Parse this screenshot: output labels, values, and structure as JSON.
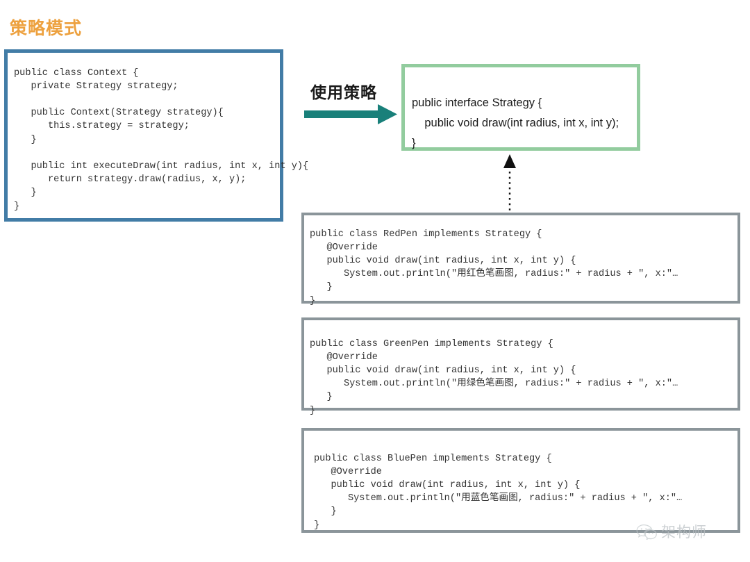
{
  "slide": {
    "title": "策略模式",
    "title_color": "#EDA13F",
    "background": "#ffffff"
  },
  "context_box": {
    "name": "Context",
    "border_color": "#427CA6",
    "code": "public class Context {\n   private Strategy strategy;\n\n   public Context(Strategy strategy){\n      this.strategy = strategy;\n   }\n\n   public int executeDraw(int radius, int x, int y){\n      return strategy.draw(radius, x, y);\n   }\n}"
  },
  "arrow": {
    "label": "使用策略",
    "color": "#19807A",
    "direction": "right"
  },
  "strategy_box": {
    "name": "Strategy",
    "border_color": "#92CC9E",
    "code": "public interface Strategy {\n    public void draw(int radius, int x, int y);\n}"
  },
  "realization_arrow": {
    "style": "dotted",
    "head": "solid-triangle",
    "direction": "up",
    "color": "#111111"
  },
  "implementations": [
    {
      "name": "RedPen",
      "border_color": "#8B959A",
      "code": "public class RedPen implements Strategy {\n   @Override\n   public void draw(int radius, int x, int y) {\n      System.out.println(\"用红色笔画图, radius:\" + radius + \", x:\"…\n   }\n}"
    },
    {
      "name": "GreenPen",
      "border_color": "#8B959A",
      "code": "public class GreenPen implements Strategy {\n   @Override\n   public void draw(int radius, int x, int y) {\n      System.out.println(\"用绿色笔画图, radius:\" + radius + \", x:\"…\n   }\n}"
    },
    {
      "name": "BluePen",
      "border_color": "#8B959A",
      "code": "public class BluePen implements Strategy {\n   @Override\n   public void draw(int radius, int x, int y) {\n      System.out.println(\"用蓝色笔画图, radius:\" + radius + \", x:\"…\n   }\n}"
    }
  ],
  "watermark": {
    "text": "架构师",
    "icon": "wechat-icon",
    "color": "#b9bfc3"
  }
}
